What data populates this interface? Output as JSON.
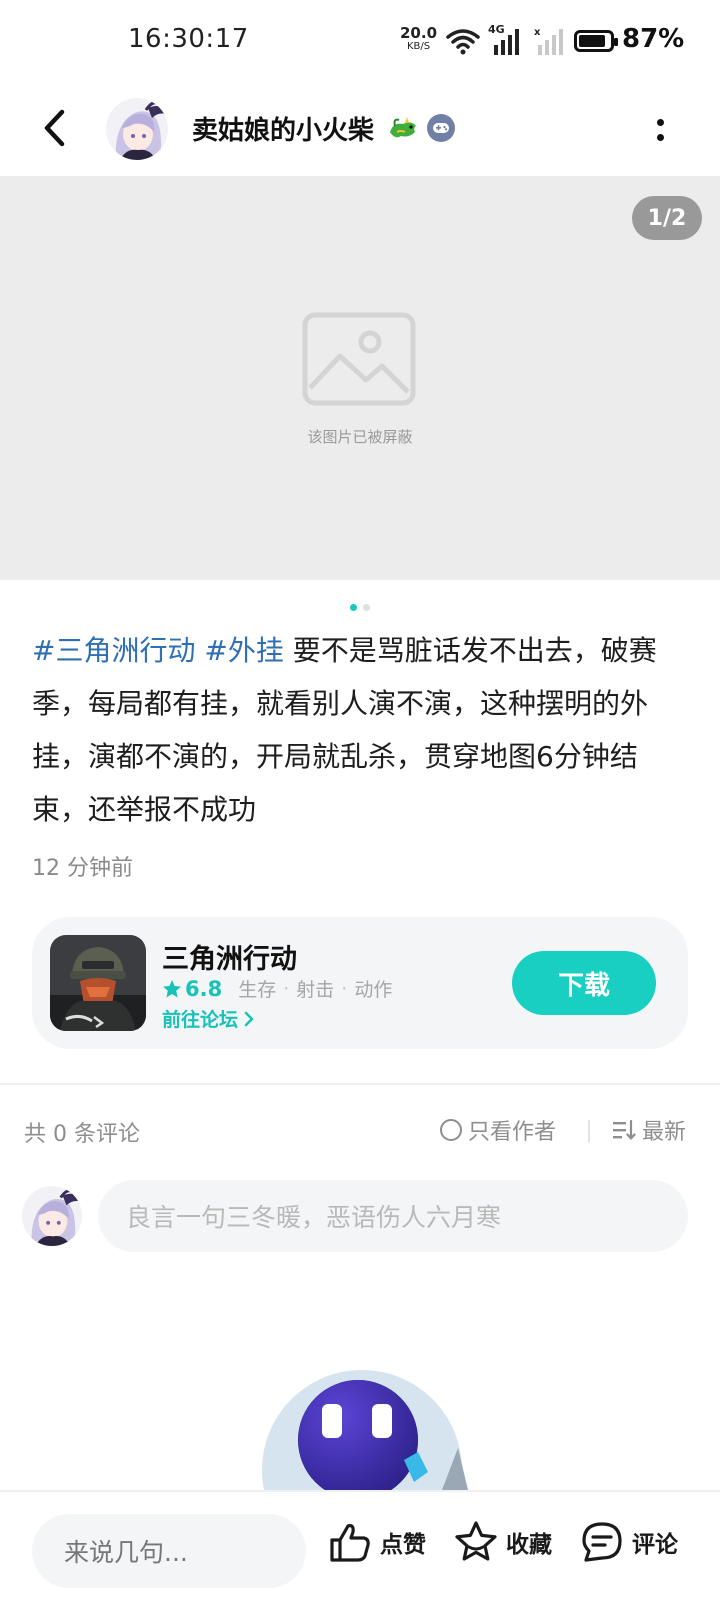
{
  "status_bar": {
    "time": "16:30:17",
    "net_speed": "20.0",
    "net_unit": "KB/S",
    "network_type": "4G",
    "battery_percent": "87%",
    "battery_level": 0.87
  },
  "header": {
    "username": "卖姑娘的小火柴",
    "avatar_icon": "anime-girl-avatar",
    "badge_icon": "gamepad-badge-icon",
    "emoji_icon": "dragon-emoji-icon"
  },
  "image_viewer": {
    "counter": "1/2",
    "blocked_text": "该图片已被屏蔽",
    "current_page": 1,
    "total_pages": 2
  },
  "post": {
    "tags": [
      "#三角洲行动",
      "#外挂"
    ],
    "body": "要不是骂脏话发不出去，破赛季，每局都有挂，就看别人演不演，这种摆明的外挂，演都不演的，开局就乱杀，贯穿地图6分钟结束，还举报不成功",
    "time_ago": "12 分钟前"
  },
  "game_card": {
    "name": "三角洲行动",
    "rating": "6.8",
    "genres": [
      "生存",
      "射击",
      "动作"
    ],
    "forum_link": "前往论坛",
    "download_label": "下载"
  },
  "comments": {
    "count_label": "共 0 条评论",
    "author_only_label": "只看作者",
    "sort_label": "最新",
    "input_placeholder": "良言一句三冬暖，恶语伤人六月寒"
  },
  "bottom_bar": {
    "input_placeholder": "来说几句...",
    "like_label": "点赞",
    "favorite_label": "收藏",
    "comment_label": "评论"
  },
  "colors": {
    "accent": "#18cfc1",
    "tag": "#2f6fb3",
    "muted": "#8e8e8e"
  }
}
